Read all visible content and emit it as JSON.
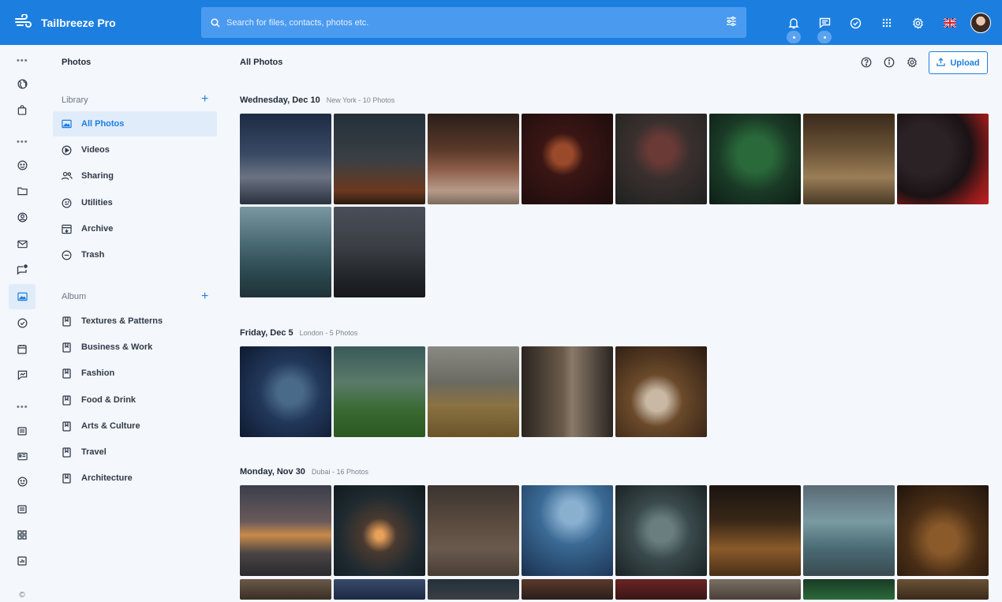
{
  "topbar": {
    "brand": "Tailbreeze Pro",
    "search_placeholder": "Search for files, contacts, photos etc.",
    "icons": [
      "bell-icon",
      "message-icon",
      "check-circle-icon",
      "apps-icon",
      "settings-icon",
      "uk-flag-icon",
      "user-avatar"
    ]
  },
  "sidebar": {
    "title": "Photos",
    "library_label": "Library",
    "library": [
      {
        "label": "All Photos",
        "icon": "image-icon",
        "active": true
      },
      {
        "label": "Videos",
        "icon": "play-circle-icon"
      },
      {
        "label": "Sharing",
        "icon": "users-icon"
      },
      {
        "label": "Utilities",
        "icon": "tools-icon"
      },
      {
        "label": "Archive",
        "icon": "archive-icon"
      },
      {
        "label": "Trash",
        "icon": "minus-circle-icon"
      }
    ],
    "album_label": "Album",
    "albums": [
      {
        "label": "Textures & Patterns"
      },
      {
        "label": "Business & Work"
      },
      {
        "label": "Fashion"
      },
      {
        "label": "Food & Drink"
      },
      {
        "label": "Arts & Culture"
      },
      {
        "label": "Travel"
      },
      {
        "label": "Architecture"
      }
    ]
  },
  "main": {
    "title": "All Photos",
    "upload_label": "Upload",
    "groups": [
      {
        "date": "Wednesday, Dec 10",
        "meta": "New York - 10 Photos"
      },
      {
        "date": "Friday, Dec 5",
        "meta": "London - 5 Photos"
      },
      {
        "date": "Monday, Nov 30",
        "meta": "Dubai - 16 Photos"
      }
    ]
  },
  "colors": {
    "accent": "#1c7fe0",
    "topbar": "#1c7fe0",
    "active_bg": "#e1ecfb"
  }
}
